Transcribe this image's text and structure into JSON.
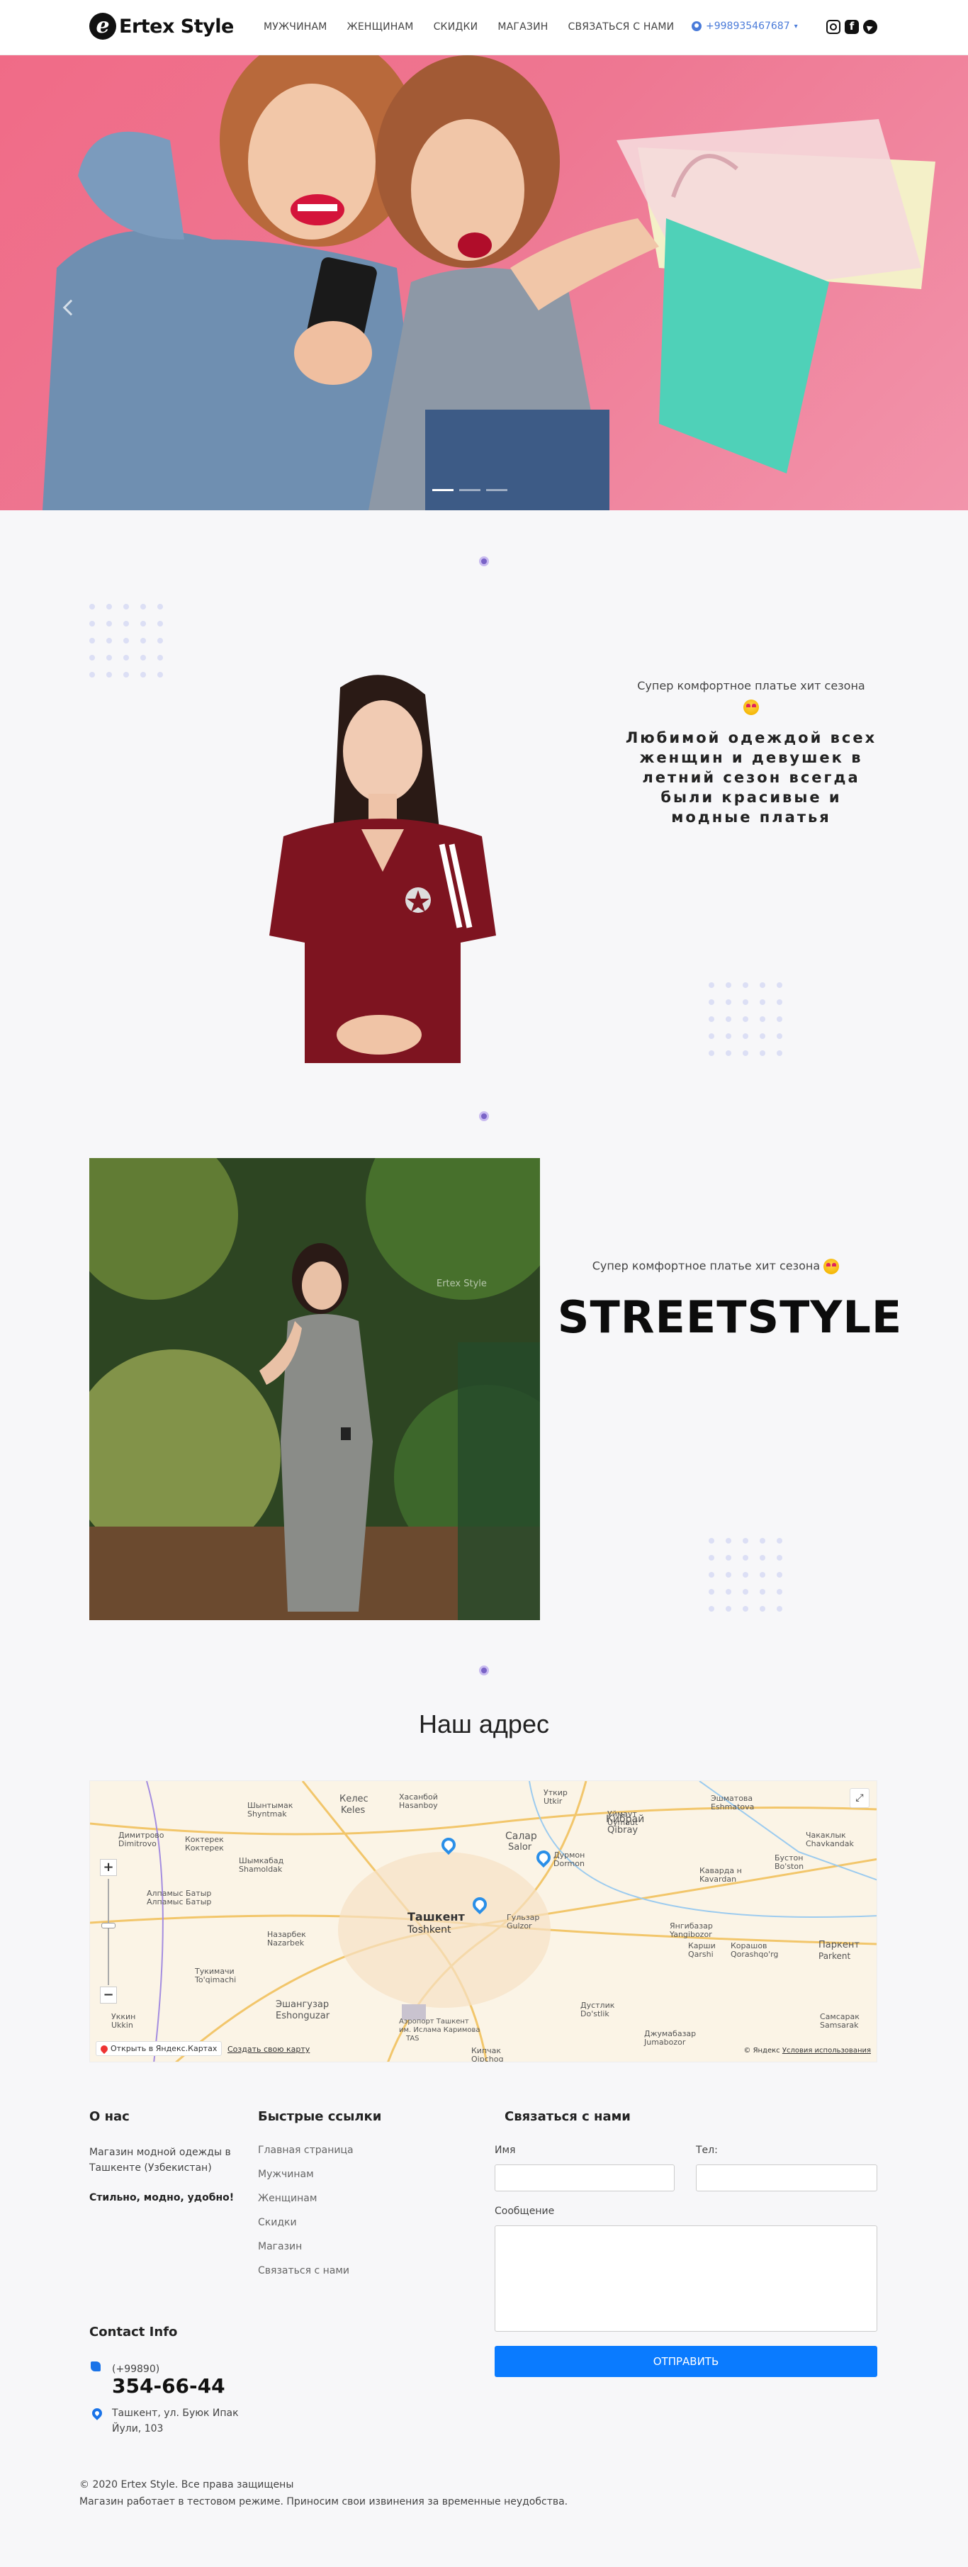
{
  "header": {
    "logo_mark": "e",
    "logo_text": "Ertex Style",
    "nav": [
      "Мужчинам",
      "Женщинам",
      "Скидки",
      "Магазин",
      "Связаться с нами"
    ],
    "phone": "+998935467687",
    "socials": [
      "instagram-icon",
      "facebook-icon",
      "telegram-icon"
    ]
  },
  "hero": {
    "slides_count": 3,
    "active_slide": 1
  },
  "section1": {
    "caption": "Супер комфортное платье хит сезона",
    "heading": "Любимой одеждой всех женщин и девушек в летний сезон всегда были красивые и модные платья"
  },
  "section2": {
    "caption": "Супер комфортное платье хит сезона",
    "title": "STREETSTYLE",
    "watermark": "Ertex Style"
  },
  "address": {
    "title": "Наш адрес",
    "map": {
      "labels": {
        "kelesh": "Келес",
        "keles": "Keles",
        "shyntmak": "Шынтымак",
        "shyntmak_lat": "Shyntmak",
        "hasanboy": "Хасанбой",
        "hasanboy_lat": "Hasanboy",
        "utkir": "Уткир",
        "utkir_lat": "Utkir",
        "uymaut": "Уймаут",
        "uymaut_lat": "Uymaut",
        "eshmatov": "Эшматова",
        "eshmatov_lat": "Eshmatova",
        "dimitrovo": "Димитрово",
        "dimitrovo_lat": "Dimitrovo",
        "kokterek": "Коктерек",
        "kokterek_lat": "Коктерек",
        "shymkabad": "Шымкабад",
        "shymkabad_lat": "Shamoldak",
        "almatbatyr": "Алпамыс Батыр",
        "almatbatyr_lat": "Алпамыс Батыр",
        "salar": "Салар",
        "salar_lat": "Salor",
        "durmon": "Дурмон",
        "durmon_lat": "Dormon",
        "kibray": "Кибрай",
        "kibray_lat": "Qibray",
        "chaklik": "Чакаклык",
        "chaklik_lat": "Chavkandak",
        "bustonb": "Бустон",
        "bustonb_lat": "Bo'ston",
        "kavardan": "Каварда н",
        "kavardan_lat": "Kavardan",
        "tashkent": "Ташкент",
        "tashkent_lat": "Toshkent",
        "gulzar": "Гульзар",
        "gulzar_lat": "Gulzor",
        "nazarbek": "Назарбек",
        "nazarbek_lat": "Nazarbek",
        "tukimachi": "Тукимачи",
        "tukimachi_lat": "To'qimachi",
        "eshangusar": "Эшангузар",
        "eshangusar_lat": "Eshonguzar",
        "yangibazar": "Янгибазар",
        "yangibazar_lat": "Yangibozor",
        "karshi": "Карши",
        "karshi_lat": "Qarshi",
        "korgan": "Корашов",
        "korgan_lat": "Qorashqo'rg",
        "parkent": "Паркент",
        "parkent_lat": "Parkent",
        "ukkim": "Уккин",
        "ukkim_lat": "Ukkin",
        "airport": "Аэропорт Ташкент",
        "karimov": "им. Ислама Каримова",
        "tas": "TAS",
        "dustlik": "Дустлик",
        "dustlik_lat": "Do'stlik",
        "jumabazar": "Джумабазар",
        "jumabazar_lat": "Jumabozor",
        "samsarak": "Самсарак",
        "samsarak_lat": "Samsarak",
        "kiichi": "Кипчак",
        "kiichi_lat": "Qipchoq"
      },
      "open_in_yandex": "Открыть в Яндекс.Картах",
      "create_map": "Создать свою карту",
      "copyright": "© Яндекс",
      "terms": "Условия использования"
    }
  },
  "footer": {
    "about_title": "О нас",
    "about_text": "Магазин модной одежды в Ташкенте (Узбекистан)",
    "about_slogan": "Стильно, модно, удобно!",
    "quick_title": "Быстрые ссылки",
    "quick_links": [
      "Главная страница",
      "Мужчинам",
      "Женщинам",
      "Скидки",
      "Магазин",
      "Связаться с нами"
    ],
    "contact_title": "Связаться с нами",
    "name_label": "Имя",
    "phone_label": "Тел:",
    "message_label": "Сообщение",
    "submit_label": "Отправить",
    "contact_info_title": "Contact Info",
    "phone_code": "(+99890)",
    "phone_number": "354-66-44",
    "address": "Ташкент, ул. Буюк Ипак Йули, 103",
    "copyright": "© 2020 Ertex Style. Все права защищены",
    "notice": "Магазин работает в тестовом режиме. Приносим свои извинения за временные неудобства."
  },
  "colors": {
    "accent": "#0a7bff",
    "link_blue": "#4a7bd9",
    "separator_purple": "#7a63c7",
    "hero_pink": "#f06b87"
  }
}
